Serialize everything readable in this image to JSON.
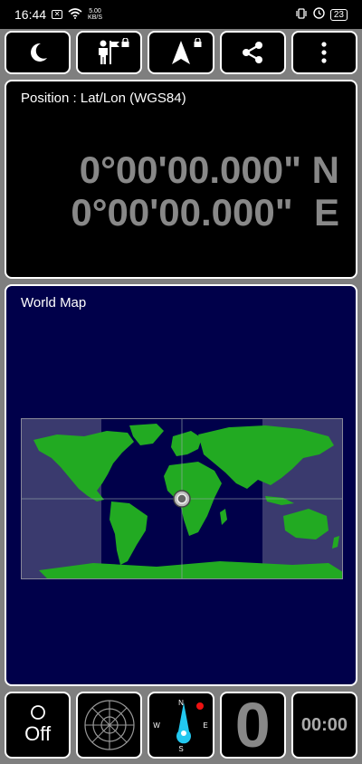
{
  "status_bar": {
    "time": "16:44",
    "speed_value": "5.00",
    "speed_unit": "KB/S",
    "battery": "23"
  },
  "toolbar": {
    "buttons": [
      {
        "icon": "moon-icon"
      },
      {
        "icon": "waypoint-person-icon",
        "locked": true
      },
      {
        "icon": "navigation-arrow-icon",
        "locked": true
      },
      {
        "icon": "share-icon"
      },
      {
        "icon": "more-vertical-icon"
      }
    ]
  },
  "position": {
    "title": "Position : Lat/Lon (WGS84)",
    "latitude": "0°00'00.000\" N",
    "longitude": "0°00'00.000\"  E"
  },
  "world_map": {
    "title": "World Map",
    "colors": {
      "background": "#00004a",
      "land": "#22aa22",
      "shade": "#6a6a8c"
    }
  },
  "bottom_bar": {
    "recording_label": "Off",
    "speed_value": "0",
    "timer": "00:00",
    "compass": {
      "n": "N",
      "s": "S",
      "e": "E",
      "w": "W"
    }
  }
}
